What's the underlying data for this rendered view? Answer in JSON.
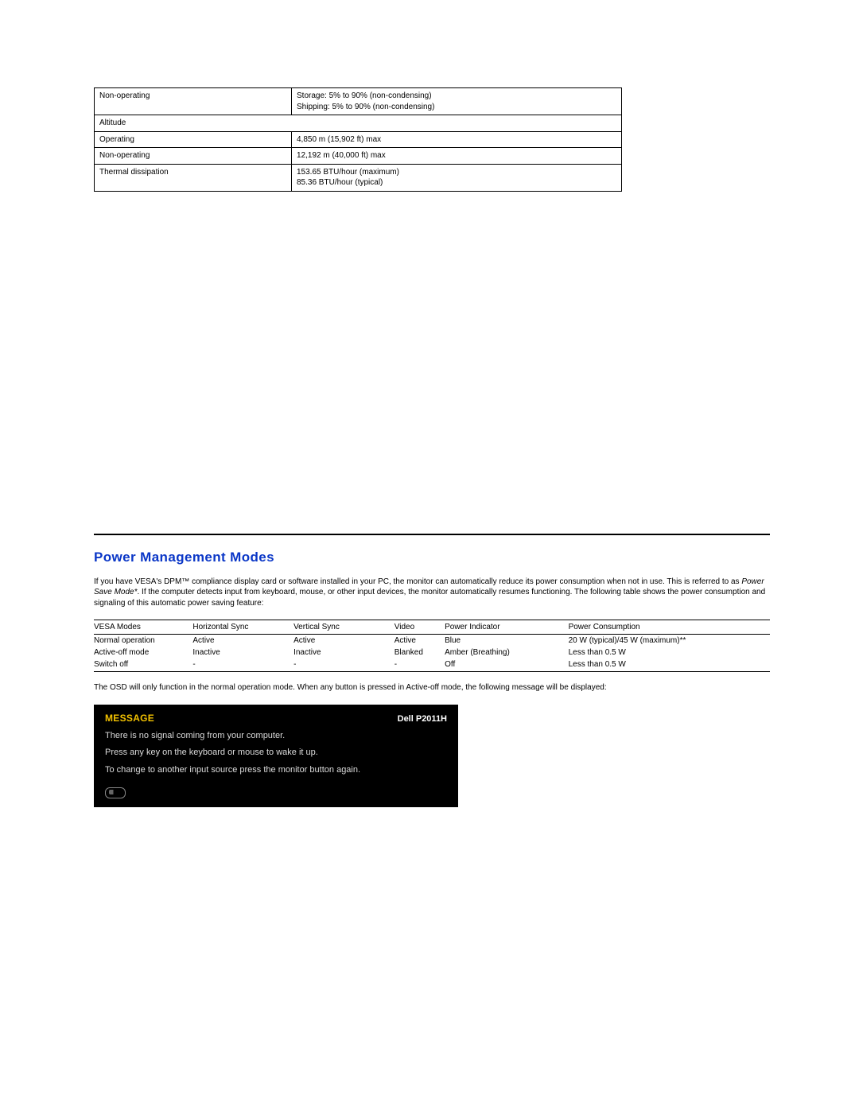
{
  "spec_table": {
    "rows": [
      {
        "label": "Non-operating",
        "value": "Storage: 5% to 90% (non-condensing)\nShipping: 5% to 90% (non-condensing)"
      },
      {
        "label": "Altitude",
        "full": true
      },
      {
        "label": "Operating",
        "value": "4,850 m (15,902 ft) max"
      },
      {
        "label": "Non-operating",
        "value": "12,192 m (40,000 ft) max"
      },
      {
        "label": "Thermal dissipation",
        "value": "153.65 BTU/hour (maximum)\n85.36 BTU/hour (typical)"
      }
    ]
  },
  "section": {
    "title": "Power Management Modes",
    "intro_pre": "If you have VESA's DPM™ compliance display card or software installed in your PC, the monitor can automatically reduce its power consumption when not in use. This is referred to as ",
    "intro_ital": "Power Save Mode*",
    "intro_post": ". If the computer detects input from keyboard, mouse, or other input devices, the monitor automatically resumes functioning. The following table shows the power consumption and signaling of this automatic power saving feature:"
  },
  "power_table": {
    "headers": [
      "VESA Modes",
      "Horizontal Sync",
      "Vertical Sync",
      "Video",
      "Power Indicator",
      "Power Consumption"
    ],
    "rows": [
      [
        "Normal operation",
        "Active",
        "Active",
        "Active",
        "Blue",
        "20 W (typical)/45 W (maximum)**"
      ],
      [
        "Active-off mode",
        "Inactive",
        "Inactive",
        "Blanked",
        "Amber (Breathing)",
        "Less than 0.5 W"
      ],
      [
        "Switch off",
        "-",
        "-",
        "-",
        "Off",
        "Less than 0.5 W"
      ]
    ]
  },
  "osd_note": "The OSD will only function in the normal operation mode. When any button is pressed in Active-off mode, the following message will be displayed:",
  "osd": {
    "label": "MESSAGE",
    "model": "Dell P2011H",
    "lines": [
      "There is no signal coming from your computer.",
      "Press any key on the keyboard or mouse to wake it up.",
      "To change to another input source press the monitor button again."
    ]
  }
}
